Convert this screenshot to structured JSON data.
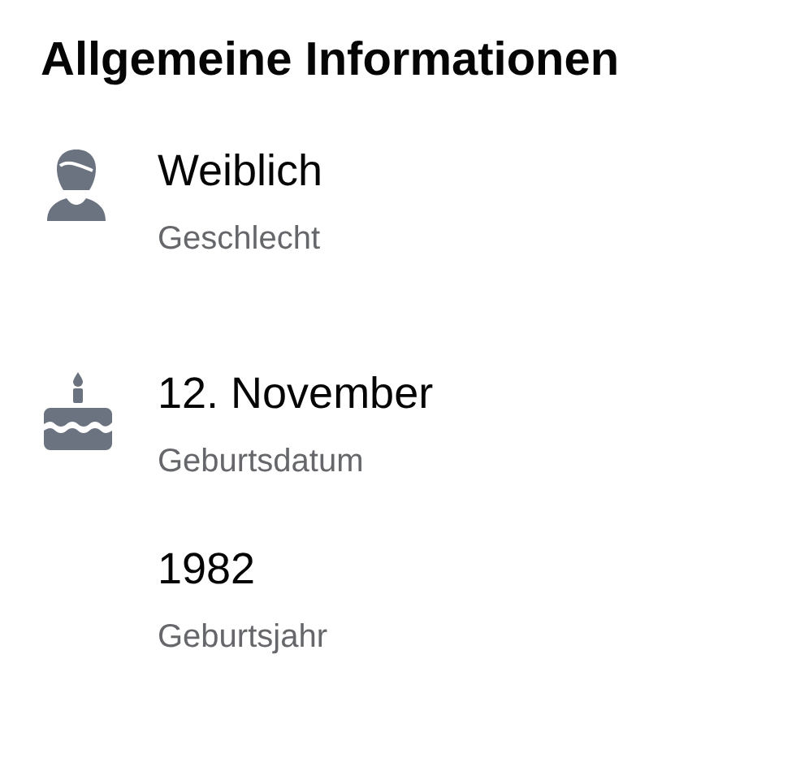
{
  "title": "Allgemeine Informationen",
  "items": [
    {
      "kind": "gender",
      "value": "Weiblich",
      "label": "Geschlecht"
    },
    {
      "kind": "birthday",
      "value": "12. November",
      "label": "Geburtsdatum"
    },
    {
      "kind": "plain",
      "value": "1982",
      "label": "Geburtsjahr"
    }
  ]
}
